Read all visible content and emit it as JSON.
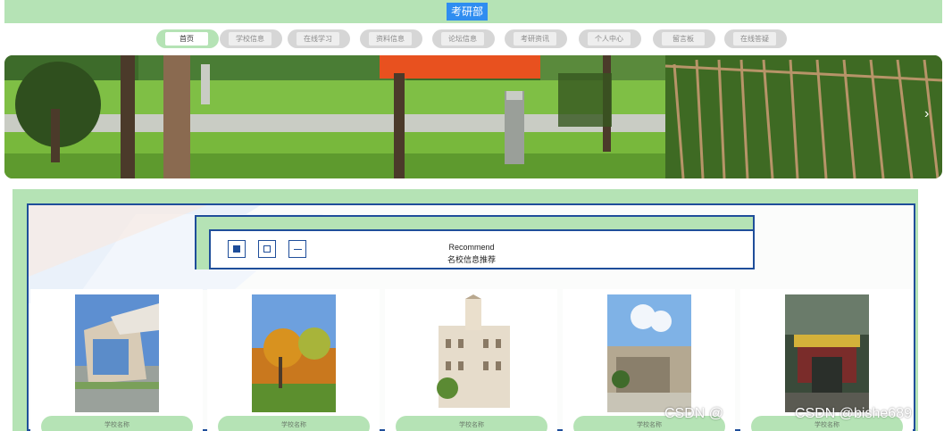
{
  "header": {
    "title": "考研部落"
  },
  "nav": {
    "items": [
      {
        "label": "首页",
        "active": true
      },
      {
        "label": "学校信息",
        "active": false
      },
      {
        "label": "在线学习",
        "active": false
      },
      {
        "label": "资料信息",
        "active": false
      },
      {
        "label": "论坛信息",
        "active": false
      },
      {
        "label": "考研资讯",
        "active": false
      },
      {
        "label": "个人中心",
        "active": false
      },
      {
        "label": "留言板",
        "active": false
      },
      {
        "label": "在线答疑",
        "active": false
      }
    ]
  },
  "banner": {
    "prev_icon": "chevron-left-icon",
    "next_icon": "chevron-right-icon",
    "next_glyph": "›"
  },
  "recommend": {
    "title_en": "Recommend",
    "title_cn": "名校信息推荐",
    "icons": [
      "filled-square-icon",
      "hollow-square-icon",
      "minus-icon"
    ]
  },
  "schools": [
    {
      "label": "学校名称"
    },
    {
      "label": "学校名称"
    },
    {
      "label": "学校名称"
    },
    {
      "label": "学校名称"
    },
    {
      "label": "学校名称"
    }
  ],
  "watermarks": {
    "left": "CSDN @",
    "right": "CSDN @bishe689"
  },
  "colors": {
    "accent_green": "#b5e3b5",
    "border_blue": "#1f4e9a",
    "title_blue": "#2f8df0"
  }
}
